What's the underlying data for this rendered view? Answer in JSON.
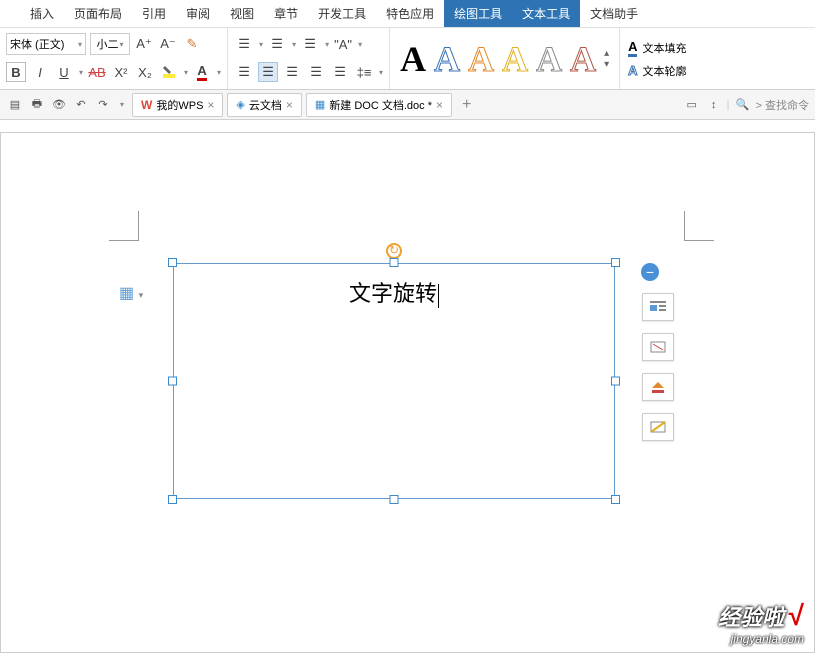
{
  "menu": {
    "items": [
      "插入",
      "页面布局",
      "引用",
      "审阅",
      "视图",
      "章节",
      "开发工具",
      "特色应用",
      "绘图工具",
      "文本工具",
      "文档助手"
    ],
    "active_indices": [
      8,
      9
    ]
  },
  "ribbon": {
    "font_name": "宋体 (正文)",
    "font_size": "小二",
    "styles_colors": [
      "#000000",
      "#3a6fb5",
      "#e08a2c",
      "#e0b020",
      "#888888",
      "#b05545"
    ],
    "right_items": [
      "文本填充",
      "文本轮廓"
    ]
  },
  "tabs": {
    "items": [
      {
        "icon": "W",
        "label": "我的WPS",
        "color": "#d84a3a"
      },
      {
        "icon": "cube",
        "label": "云文档",
        "color": "#3a8acc"
      },
      {
        "icon": "doc",
        "label": "新建 DOC 文档.doc *",
        "color": "#3a8acc",
        "active": true
      }
    ],
    "search_hint": "查找命令"
  },
  "document": {
    "text": "文字旋转"
  },
  "watermark": {
    "cn": "经验啦",
    "check": "√",
    "en": "jingyanla.com"
  }
}
